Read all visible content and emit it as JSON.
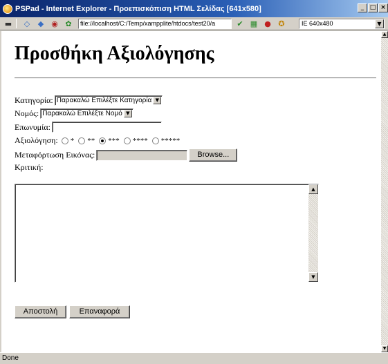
{
  "window": {
    "title": "PSPad - Internet Explorer - Προεπισκόπιση HTML Σελίδας  [641x580]",
    "controls": [
      "_",
      "□",
      "×"
    ]
  },
  "toolbar": {
    "address": "file://localhost/C:/Temp/xampplite/htdocs/test20/a",
    "resolution": "IE 640x480"
  },
  "page": {
    "heading": "Προσθήκη Αξιολόγησης",
    "category_label": "Κατηγορία:",
    "category_select": "Παρακαλώ Επιλέξτε Κατηγορία",
    "prefecture_label": "Νομός:",
    "prefecture_select": "Παρακαλώ Επιλέξτε Νομό",
    "name_label": "Επωνυμία:",
    "rating_label": "Αξιολόγηση:",
    "rating_options": [
      "*",
      "**",
      "***",
      "****",
      "*****"
    ],
    "rating_selected_index": 2,
    "image_upload_label": "Μεταφόρτωση Εικόνας:",
    "browse_button": "Browse...",
    "review_label": "Κριτική:",
    "submit_button": "Αποστολή",
    "reset_button": "Επαναφορά"
  },
  "statusbar": {
    "text": "Done"
  }
}
